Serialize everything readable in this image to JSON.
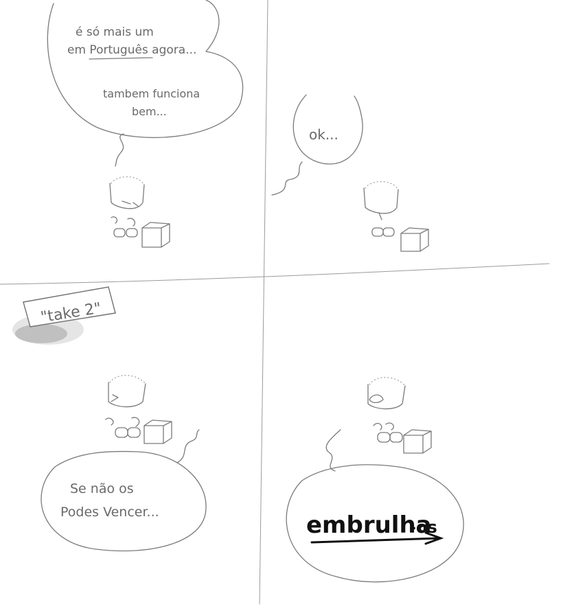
{
  "panels": [
    {
      "id": "top-left",
      "speech_lines": [
        "é só mais um",
        "em Português agora...",
        "tambem funciona",
        "bem..."
      ],
      "underlined_word": "Português"
    },
    {
      "id": "top-right",
      "speech_lines": [
        "ok..."
      ]
    },
    {
      "id": "bottom-left",
      "sign_text": "\"take 2\"",
      "speech_lines": [
        "Se não os",
        "Podes Vencer..."
      ]
    },
    {
      "id": "bottom-right",
      "speech_main": "embrulha",
      "speech_suffix": "-os"
    }
  ],
  "colors": {
    "paper": "#ffffff",
    "pencil": "#7a7a7a",
    "dark_ink": "#111111"
  },
  "icons": [
    "character-icon",
    "box-icon"
  ]
}
